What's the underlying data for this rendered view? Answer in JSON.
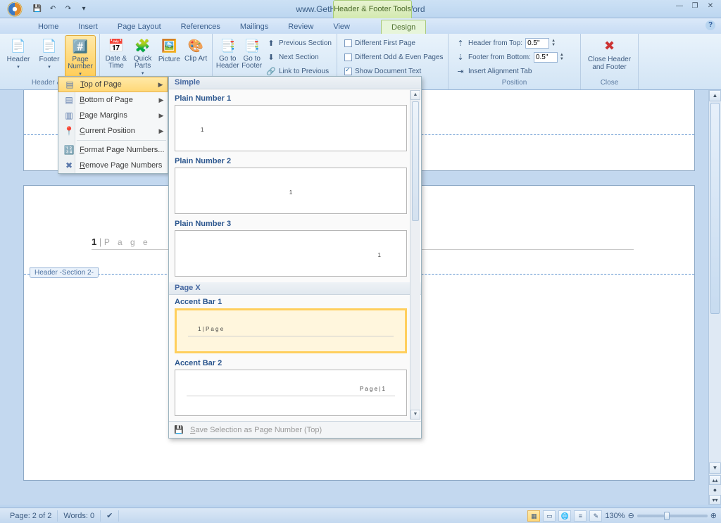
{
  "titlebar": {
    "title": "www.GetHow.org - Microsoft Word",
    "context_tab": "Header & Footer Tools"
  },
  "tabs": {
    "home": "Home",
    "insert": "Insert",
    "layout": "Page Layout",
    "references": "References",
    "mailings": "Mailings",
    "review": "Review",
    "view": "View",
    "design": "Design"
  },
  "ribbon": {
    "hf_group": "Header & F",
    "header": "Header",
    "footer": "Footer",
    "page_number": "Page Number",
    "date_time": "Date & Time",
    "quick_parts": "Quick Parts",
    "picture": "Picture",
    "clip_art": "Clip Art",
    "goto_header": "Go to Header",
    "goto_footer": "Go to Footer",
    "prev_section": "Previous Section",
    "next_section": "Next Section",
    "link_prev": "Link to Previous",
    "diff_first": "Different First Page",
    "diff_oe": "Different Odd & Even Pages",
    "show_doc": "Show Document Text",
    "header_top": "Header from Top:",
    "footer_bottom": "Footer from Bottom:",
    "align_tab": "Insert Alignment Tab",
    "ht_val": "0.5\"",
    "fb_val": "0.5\"",
    "position": "Position",
    "close_hf": "Close Header and Footer",
    "close": "Close"
  },
  "pn_menu": {
    "top": "Top of Page",
    "bottom": "Bottom of Page",
    "margins": "Page Margins",
    "current": "Current Position",
    "format": "Format Page Numbers...",
    "remove": "Remove Page Numbers"
  },
  "gallery": {
    "cat_simple": "Simple",
    "pn1": "Plain Number 1",
    "pn2": "Plain Number 2",
    "pn3": "Plain Number 3",
    "cat_pagex": "Page X",
    "ab1": "Accent Bar 1",
    "ab2": "Accent Bar 2",
    "pv_ab1": "1 | P a g e",
    "pv_ab2": "P a g e | 1",
    "save_sel": "Save Selection as Page Number (Top)"
  },
  "doc": {
    "pg_num_display_1": "1",
    "pg_num_display_bar": " | ",
    "pg_num_display_rest": "P a g e",
    "section_tag": "Header -Section 2-"
  },
  "status": {
    "page": "Page: 2 of 2",
    "words": "Words: 0",
    "zoom": "130%"
  }
}
